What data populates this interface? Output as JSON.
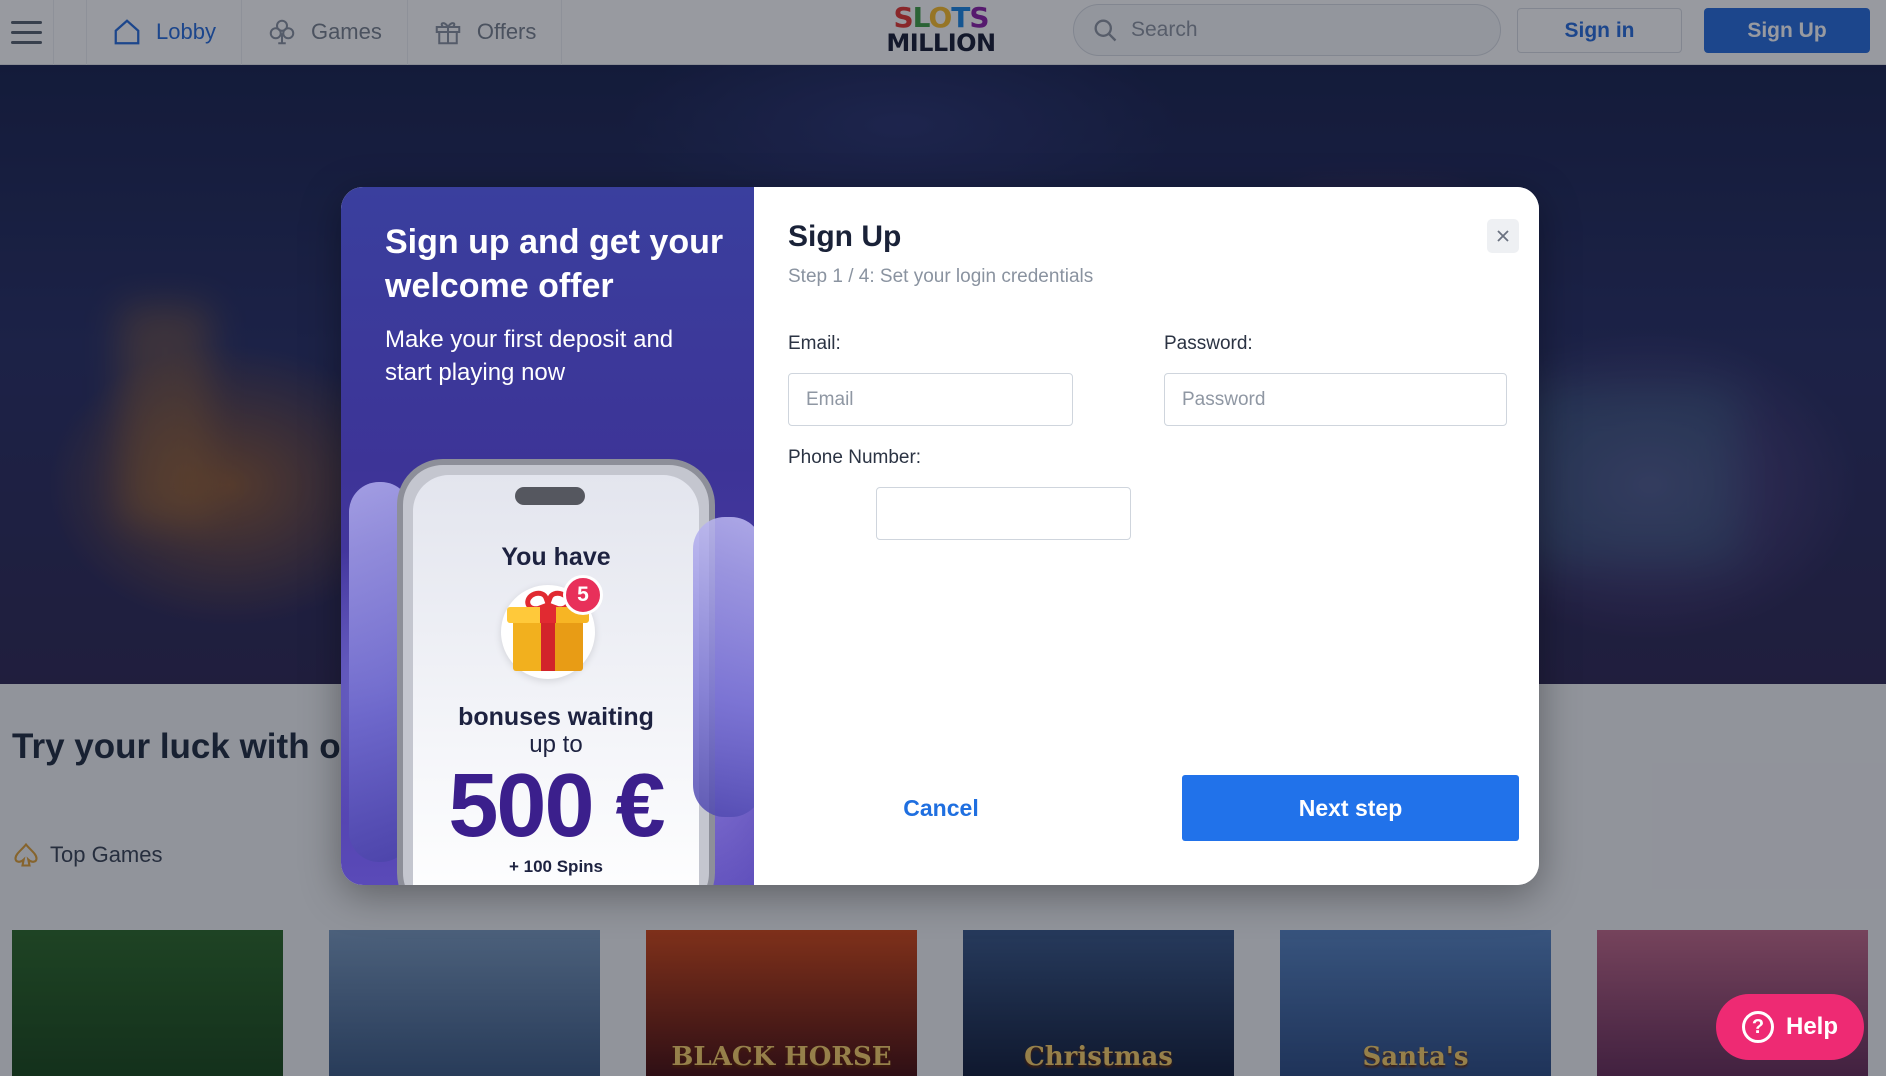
{
  "header": {
    "nav": [
      {
        "label": "Lobby",
        "icon": "home-icon",
        "active": true
      },
      {
        "label": "Games",
        "icon": "club-icon",
        "active": false
      },
      {
        "label": "Offers",
        "icon": "gift-icon",
        "active": false
      }
    ],
    "logo": {
      "line1": "SLOTS",
      "line2": "MILLION"
    },
    "search_placeholder": "Search",
    "signin_label": "Sign in",
    "signup_label": "Sign Up"
  },
  "page": {
    "try_heading": "Try your luck with ou",
    "top_games_label": "Top Games",
    "thumbnails": [
      {
        "title": "",
        "colors": [
          "#2e6a2a",
          "#1c4a1c"
        ]
      },
      {
        "title": "",
        "colors": [
          "#7c9cc0",
          "#3f5d86"
        ]
      },
      {
        "title": "BLACK HORSE",
        "colors": [
          "#d44a1a",
          "#4a1010"
        ]
      },
      {
        "title": "Christmas",
        "colors": [
          "#3c5a8a",
          "#14203c"
        ]
      },
      {
        "title": "Santa's",
        "colors": [
          "#5a87c4",
          "#2f4f86"
        ]
      },
      {
        "title": "",
        "colors": [
          "#c46a8a",
          "#6a2f5a"
        ]
      }
    ]
  },
  "promo": {
    "title": "Sign up and get your welcome offer",
    "subtitle": "Make your first deposit and start playing now",
    "you_have": "You have",
    "badge_count": "5",
    "bonuses": "bonuses waiting",
    "upto": "up to",
    "amount": "500 €",
    "spins": "+ 100 Spins"
  },
  "form": {
    "title": "Sign Up",
    "step": "Step 1 / 4: Set your login credentials",
    "email_label": "Email:",
    "email_placeholder": "Email",
    "password_label": "Password:",
    "password_placeholder": "Password",
    "phone_label": "Phone Number:",
    "phone_value": "",
    "cancel_label": "Cancel",
    "next_label": "Next step"
  },
  "help": {
    "label": "Help",
    "icon_glyph": "?"
  },
  "colors": {
    "primary": "#2a6fdc",
    "help": "#ee2a73",
    "amount": "#3b1f8c"
  }
}
